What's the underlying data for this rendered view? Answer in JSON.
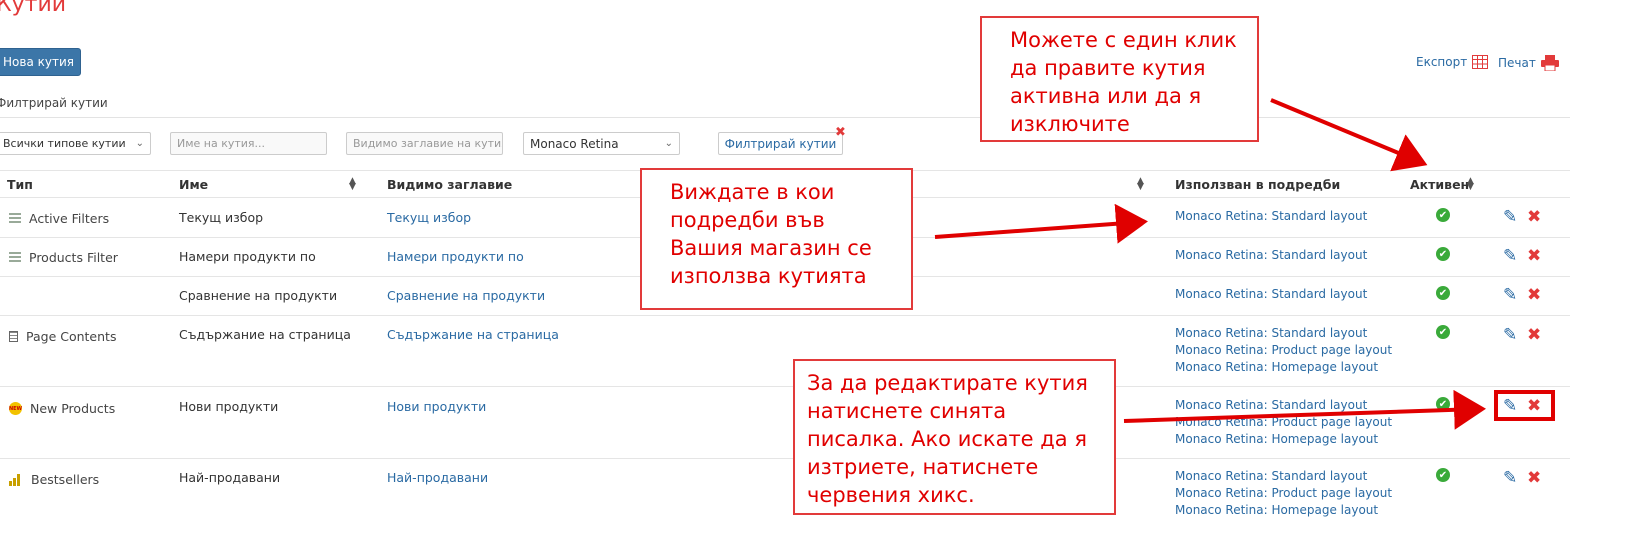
{
  "page": {
    "title": "Кутии"
  },
  "toolbar": {
    "new_label": "Нова кутия",
    "export_label": "Експорт",
    "print_label": "Печат"
  },
  "filters": {
    "title": "Филтрирай кутии",
    "type_select": "Всички типове кутии",
    "name_placeholder": "Име на кутия...",
    "visible_title_placeholder": "Видимо заглавие на кутия",
    "theme_select": "Monaco Retina",
    "filter_button": "Филтрирай кутии",
    "clear_icon": "close-icon"
  },
  "table": {
    "headers": {
      "type": "Тип",
      "name": "Име",
      "visible_title": "Видимо заглавие",
      "layouts": "Използван в подредби",
      "active": "Активен"
    },
    "rows": [
      {
        "type": "Active Filters",
        "icon": "list-icon",
        "name": "Текущ избор",
        "visible_title": "Текущ избор",
        "layouts": [
          "Monaco Retina: Standard layout"
        ]
      },
      {
        "type": "Products Filter",
        "icon": "list-icon",
        "name": "Намери продукти по",
        "visible_title": "Намери продукти по",
        "layouts": [
          "Monaco Retina: Standard layout"
        ]
      },
      {
        "type": "",
        "icon": "",
        "name": "Сравнение на продукти",
        "visible_title": "Сравнение на продукти",
        "layouts": [
          "Monaco Retina: Standard layout"
        ]
      },
      {
        "type": "Page Contents",
        "icon": "page-icon",
        "name": "Съдържание на страница",
        "visible_title": "Съдържание на страница",
        "layouts": [
          "Monaco Retina: Standard layout",
          "Monaco Retina: Product page layout",
          "Monaco Retina: Homepage layout"
        ]
      },
      {
        "type": "New Products",
        "icon": "new-badge-icon",
        "name": "Нови продукти",
        "visible_title": "Нови продукти",
        "layouts": [
          "Monaco Retina: Standard layout",
          "Monaco Retina: Product page layout",
          "Monaco Retina: Homepage layout"
        ]
      },
      {
        "type": "Bestsellers",
        "icon": "bar-chart-icon",
        "name": "Най-продавани",
        "visible_title": "Най-продавани",
        "layouts": [
          "Monaco Retina: Standard layout",
          "Monaco Retina: Product page layout",
          "Monaco Retina: Homepage layout"
        ]
      }
    ]
  },
  "annotations": {
    "active_note": "Можете с един клик да правите кутия активна или да я изключите",
    "layouts_note": "Виждате в кои подредби във Вашия магазин се използва кутията",
    "edit_note": "За да редактирате кутия натиснете синята писалка. Ако искате да я изтриете, натиснете червения хикс."
  },
  "colors": {
    "accent": "#3c76a8",
    "link": "#2a6aa3",
    "danger": "#e23a3a",
    "success": "#3aaa3a"
  }
}
